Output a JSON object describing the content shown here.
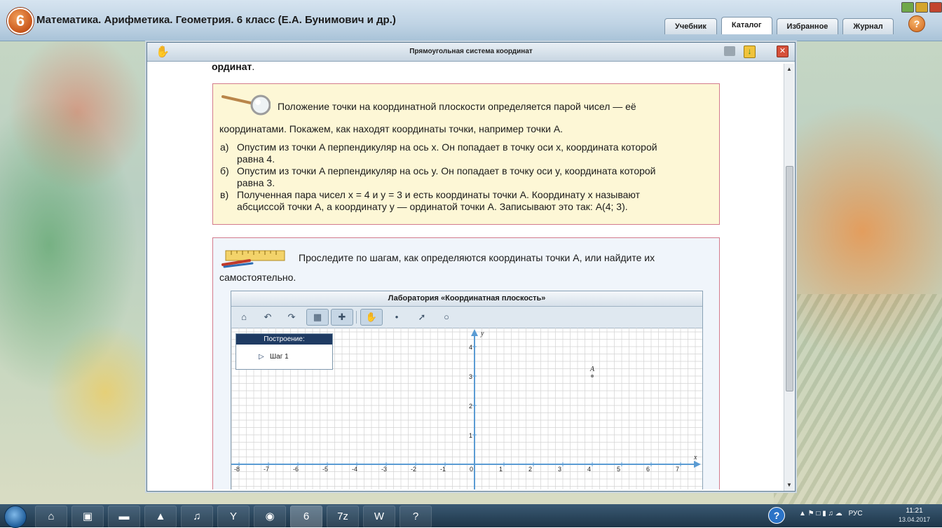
{
  "app": {
    "logo_number": "6",
    "title": "Математика. Арифметика. Геометрия. 6 класс (Е.А. Бунимович и др.)",
    "tabs": [
      "Учебник",
      "Каталог",
      "Избранное",
      "Журнал"
    ],
    "active_tab": "Каталог",
    "help_label": "?"
  },
  "document": {
    "title": "Прямоугольная система координат",
    "top_word": "ординат",
    "top_word_suffix": "."
  },
  "info": {
    "p1": "Положение точки на координатной плоскости определяется парой чисел — её",
    "p1b": "координатами. Покажем, как находят координаты точки, например точки A.",
    "items": [
      {
        "marker": "а)",
        "line1": "Опустим из точки A перпендикуляр на ось x. Он попадает в точку оси x, координата которой",
        "line2": "равна 4."
      },
      {
        "marker": "б)",
        "line1": "Опустим из точки A перпендикуляр на ось y. Он попадает в точку оси y, координата которой",
        "line2": "равна 3."
      },
      {
        "marker": "в)",
        "line1": "Полученная пара чисел x = 4 и y = 3 и есть координаты точки A. Координату x называют",
        "line2": "абсциссой точки A, а координату y — ординатой точки A. Записывают это так: A(4; 3)."
      }
    ]
  },
  "task": {
    "p1": "Проследите по шагам, как определяются координаты точки A, или найдите их",
    "p1b": "самостоятельно."
  },
  "lab": {
    "title": "Лаборатория «Координатная плоскость»",
    "build_header": "Построение:",
    "step_label": "Шаг 1",
    "x_axis_label": "x",
    "y_axis_label": "y",
    "x_ticks": [
      "-8",
      "-7",
      "-6",
      "-5",
      "-4",
      "-3",
      "-2",
      "-1",
      "0",
      "1",
      "2",
      "3",
      "4",
      "5",
      "6",
      "7"
    ],
    "y_ticks": [
      "1",
      "2",
      "3",
      "4"
    ],
    "point": {
      "label": "A",
      "x": 4,
      "y": 3
    }
  },
  "taskbar": {
    "lang": "РУС",
    "time": "11:21",
    "date": "13.04.2017"
  }
}
